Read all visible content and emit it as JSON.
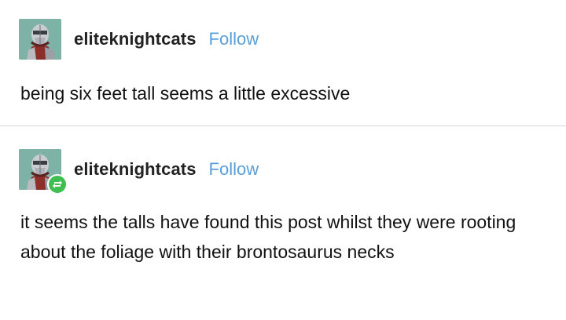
{
  "posts": [
    {
      "username": "eliteknightcats",
      "follow_label": "Follow",
      "text": "being six feet tall seems a little excessive",
      "avatar_icon": "knight-avatar-icon",
      "is_reblog": false
    },
    {
      "username": "eliteknightcats",
      "follow_label": "Follow",
      "text": "it seems the talls have found this post whilst they were rooting about the foliage with their brontosaurus necks",
      "avatar_icon": "knight-avatar-icon",
      "is_reblog": true,
      "reblog_icon": "reblog-icon"
    }
  ],
  "colors": {
    "follow": "#5aa0d8",
    "reblog_badge": "#3fbf52",
    "avatar_bg": "#7fb2a6"
  }
}
